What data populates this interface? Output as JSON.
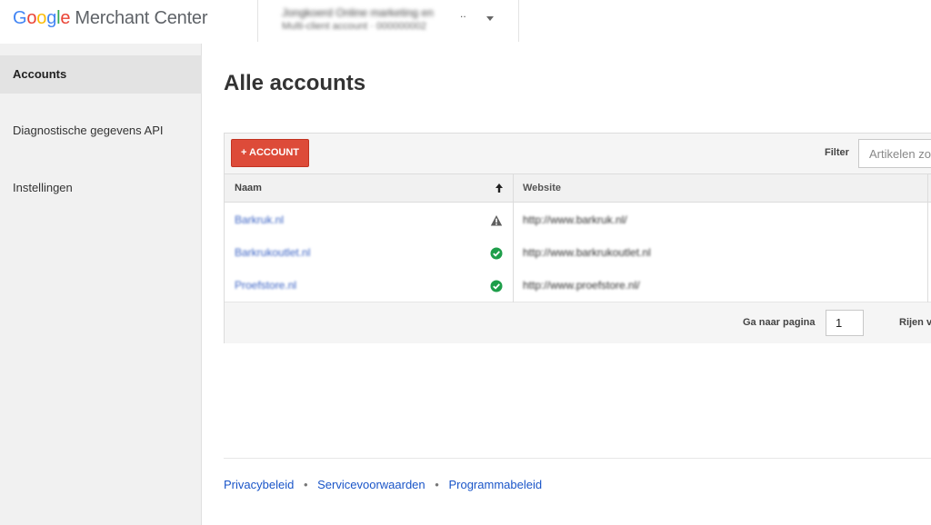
{
  "header": {
    "logo_letters": [
      "G",
      "o",
      "o",
      "g",
      "l",
      "e"
    ],
    "product_name": "Merchant Center",
    "account": {
      "name": "Jongkoerd Online marketing en",
      "name_suffix": "..",
      "sub": "Multi-client account  ·  000000002"
    }
  },
  "sidebar": {
    "items": [
      {
        "label": "Accounts",
        "active": true
      },
      {
        "label": "Diagnostische gegevens API",
        "active": false
      },
      {
        "label": "Instellingen",
        "active": false
      }
    ]
  },
  "main": {
    "title": "Alle accounts",
    "toolbar": {
      "add_button": "+ ACCOUNT",
      "filter_label": "Filter",
      "filter_placeholder": "Artikelen zo"
    },
    "table": {
      "columns": [
        "Naam",
        "Website"
      ],
      "rows": [
        {
          "name": "Barkruk.nl",
          "website": "http://www.barkruk.nl/",
          "status": "warning"
        },
        {
          "name": "Barkrukoutlet.nl",
          "website": "http://www.barkrukoutlet.nl",
          "status": "ok"
        },
        {
          "name": "Proefstore.nl",
          "website": "http://www.proefstore.nl/",
          "status": "ok"
        }
      ]
    },
    "pagination": {
      "goto_label": "Ga naar pagina",
      "page": "1",
      "rows_label": "Rijen v"
    }
  },
  "footer": {
    "links": [
      "Privacybeleid",
      "Servicevoorwaarden",
      "Programmabeleid"
    ],
    "separator": "•"
  },
  "colors": {
    "accent_button": "#dd4b39",
    "link": "#1a55c8",
    "status_ok": "#1e9e4a",
    "status_warning": "#5f5f5f"
  },
  "icons": {
    "sort": "arrow-up-icon",
    "warning": "warning-triangle-icon",
    "ok": "check-circle-icon"
  }
}
